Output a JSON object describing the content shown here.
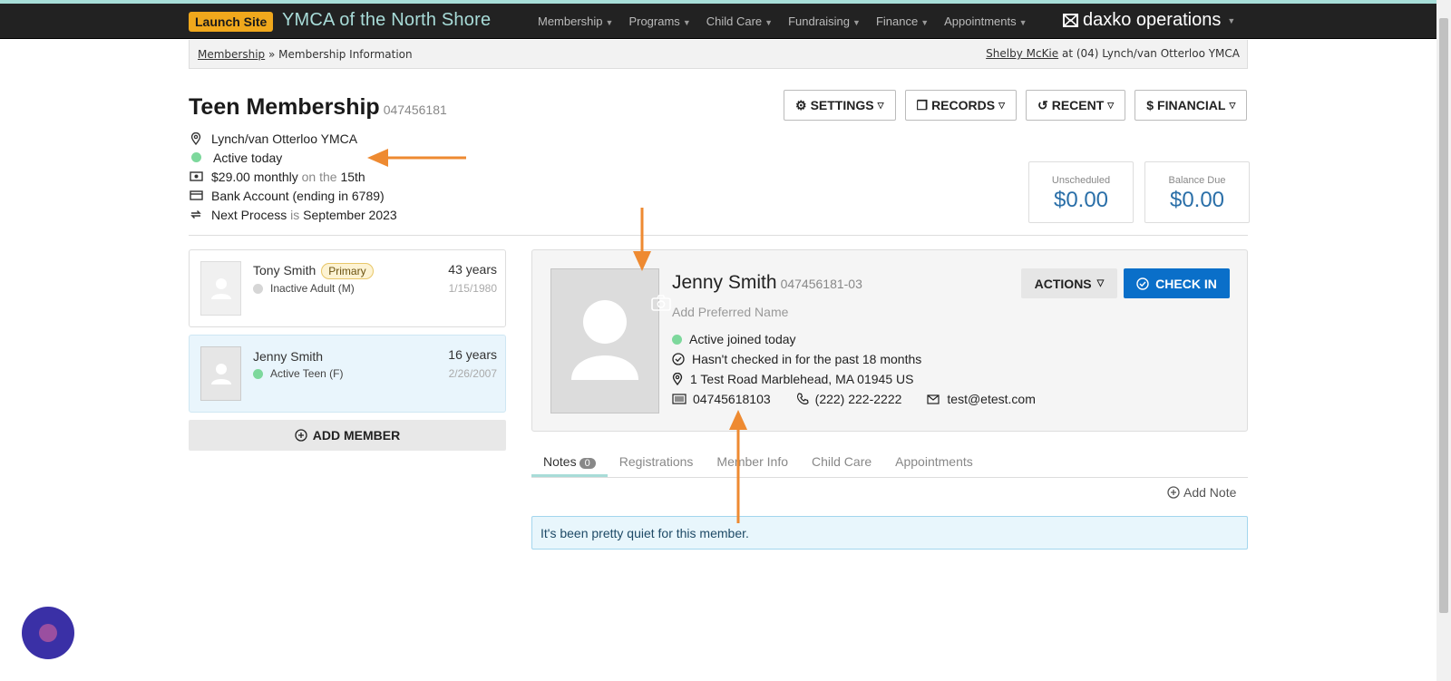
{
  "nav": {
    "launch_label": "Launch Site",
    "org_name": "YMCA of the North Shore",
    "items": [
      "Membership",
      "Programs",
      "Child Care",
      "Fundraising",
      "Finance",
      "Appointments"
    ],
    "brand": "daxko operations"
  },
  "breadcrumb": {
    "link": "Membership",
    "sep": "»",
    "current": "Membership Information",
    "user": "Shelby McKie",
    "location_text": "at (04) Lynch/van Otterloo YMCA"
  },
  "membership": {
    "title": "Teen Membership",
    "number": "047456181",
    "location": "Lynch/van Otterloo YMCA",
    "status": "Active today",
    "price": "$29.00 monthly",
    "on_the": "on the",
    "day": "15th",
    "payment": "Bank Account (ending in 6789)",
    "next_label": "Next Process",
    "is": "is",
    "next_date": "September 2023"
  },
  "toolbar": {
    "settings": "SETTINGS",
    "records": "RECORDS",
    "recent": "RECENT",
    "financial": "FINANCIAL"
  },
  "balances": {
    "unscheduled_label": "Unscheduled",
    "unscheduled_value": "$0.00",
    "due_label": "Balance Due",
    "due_value": "$0.00"
  },
  "members": [
    {
      "name": "Tony Smith",
      "badge": "Primary",
      "status": "Inactive Adult (M)",
      "age": "43 years",
      "dob": "1/15/1980"
    },
    {
      "name": "Jenny Smith",
      "status": "Active Teen (F)",
      "age": "16 years",
      "dob": "2/26/2007"
    }
  ],
  "add_member": "ADD MEMBER",
  "detail": {
    "name": "Jenny Smith",
    "number": "047456181-03",
    "pref_placeholder": "Add Preferred Name",
    "status": "Active joined today",
    "checkin": "Hasn't checked in for the past 18 months",
    "address": "1 Test Road Marblehead, MA 01945 US",
    "barcode": "04745618103",
    "phone": "(222) 222-2222",
    "email": "test@etest.com",
    "actions": "ACTIONS",
    "checkin_btn": "CHECK IN"
  },
  "tabs": {
    "notes": "Notes",
    "notes_count": "0",
    "registrations": "Registrations",
    "member_info": "Member Info",
    "child_care": "Child Care",
    "appointments": "Appointments"
  },
  "add_note": "Add Note",
  "empty_message": "It's been pretty quiet for this member."
}
